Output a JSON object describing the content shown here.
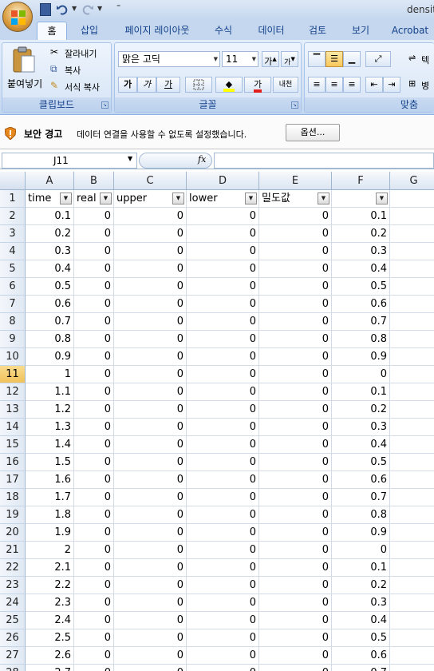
{
  "window": {
    "title": "densit"
  },
  "tabs": [
    "홈",
    "삽입",
    "페이지 레이아웃",
    "수식",
    "데이터",
    "검토",
    "보기",
    "Acrobat"
  ],
  "active_tab": "홈",
  "ribbon": {
    "clipboard": {
      "label": "클립보드",
      "paste": "붙여넣기",
      "cut": "잘라내기",
      "copy": "복사",
      "format_painter": "서식 복사"
    },
    "font": {
      "label": "글꼴",
      "family": "맑은 고딕",
      "size": "11",
      "grow": "가",
      "shrink": "가",
      "bold": "가",
      "italic": "가",
      "underline": "가",
      "font_color_glyph": "가",
      "phonetic": "내천"
    },
    "alignment": {
      "label": "맞춤",
      "wrap_text": "텍",
      "merge": "병"
    }
  },
  "security": {
    "title": "보안 경고",
    "message": "데이터 연결을 사용할 수 없도록 설정했습니다.",
    "options_button": "옵션..."
  },
  "formula_bar": {
    "name_box": "J11",
    "fx": "fx",
    "formula": ""
  },
  "active_row": "11",
  "columns": [
    "A",
    "B",
    "C",
    "D",
    "E",
    "F",
    "G"
  ],
  "header_row": {
    "row": "1",
    "cells": [
      "time",
      "real",
      "upper",
      "lower",
      "밀도값",
      ""
    ]
  },
  "rows": [
    {
      "row": "2",
      "cells": [
        "0.1",
        "0",
        "0",
        "0",
        "0",
        "0.1"
      ]
    },
    {
      "row": "3",
      "cells": [
        "0.2",
        "0",
        "0",
        "0",
        "0",
        "0.2"
      ]
    },
    {
      "row": "4",
      "cells": [
        "0.3",
        "0",
        "0",
        "0",
        "0",
        "0.3"
      ]
    },
    {
      "row": "5",
      "cells": [
        "0.4",
        "0",
        "0",
        "0",
        "0",
        "0.4"
      ]
    },
    {
      "row": "6",
      "cells": [
        "0.5",
        "0",
        "0",
        "0",
        "0",
        "0.5"
      ]
    },
    {
      "row": "7",
      "cells": [
        "0.6",
        "0",
        "0",
        "0",
        "0",
        "0.6"
      ]
    },
    {
      "row": "8",
      "cells": [
        "0.7",
        "0",
        "0",
        "0",
        "0",
        "0.7"
      ]
    },
    {
      "row": "9",
      "cells": [
        "0.8",
        "0",
        "0",
        "0",
        "0",
        "0.8"
      ]
    },
    {
      "row": "10",
      "cells": [
        "0.9",
        "0",
        "0",
        "0",
        "0",
        "0.9"
      ]
    },
    {
      "row": "11",
      "cells": [
        "1",
        "0",
        "0",
        "0",
        "0",
        "0"
      ]
    },
    {
      "row": "12",
      "cells": [
        "1.1",
        "0",
        "0",
        "0",
        "0",
        "0.1"
      ]
    },
    {
      "row": "13",
      "cells": [
        "1.2",
        "0",
        "0",
        "0",
        "0",
        "0.2"
      ]
    },
    {
      "row": "14",
      "cells": [
        "1.3",
        "0",
        "0",
        "0",
        "0",
        "0.3"
      ]
    },
    {
      "row": "15",
      "cells": [
        "1.4",
        "0",
        "0",
        "0",
        "0",
        "0.4"
      ]
    },
    {
      "row": "16",
      "cells": [
        "1.5",
        "0",
        "0",
        "0",
        "0",
        "0.5"
      ]
    },
    {
      "row": "17",
      "cells": [
        "1.6",
        "0",
        "0",
        "0",
        "0",
        "0.6"
      ]
    },
    {
      "row": "18",
      "cells": [
        "1.7",
        "0",
        "0",
        "0",
        "0",
        "0.7"
      ]
    },
    {
      "row": "19",
      "cells": [
        "1.8",
        "0",
        "0",
        "0",
        "0",
        "0.8"
      ]
    },
    {
      "row": "20",
      "cells": [
        "1.9",
        "0",
        "0",
        "0",
        "0",
        "0.9"
      ]
    },
    {
      "row": "21",
      "cells": [
        "2",
        "0",
        "0",
        "0",
        "0",
        "0"
      ]
    },
    {
      "row": "22",
      "cells": [
        "2.1",
        "0",
        "0",
        "0",
        "0",
        "0.1"
      ]
    },
    {
      "row": "23",
      "cells": [
        "2.2",
        "0",
        "0",
        "0",
        "0",
        "0.2"
      ]
    },
    {
      "row": "24",
      "cells": [
        "2.3",
        "0",
        "0",
        "0",
        "0",
        "0.3"
      ]
    },
    {
      "row": "25",
      "cells": [
        "2.4",
        "0",
        "0",
        "0",
        "0",
        "0.4"
      ]
    },
    {
      "row": "26",
      "cells": [
        "2.5",
        "0",
        "0",
        "0",
        "0",
        "0.5"
      ]
    },
    {
      "row": "27",
      "cells": [
        "2.6",
        "0",
        "0",
        "0",
        "0",
        "0.6"
      ]
    },
    {
      "row": "28",
      "cells": [
        "2.7",
        "0",
        "0",
        "0",
        "0",
        "0.7"
      ]
    }
  ]
}
